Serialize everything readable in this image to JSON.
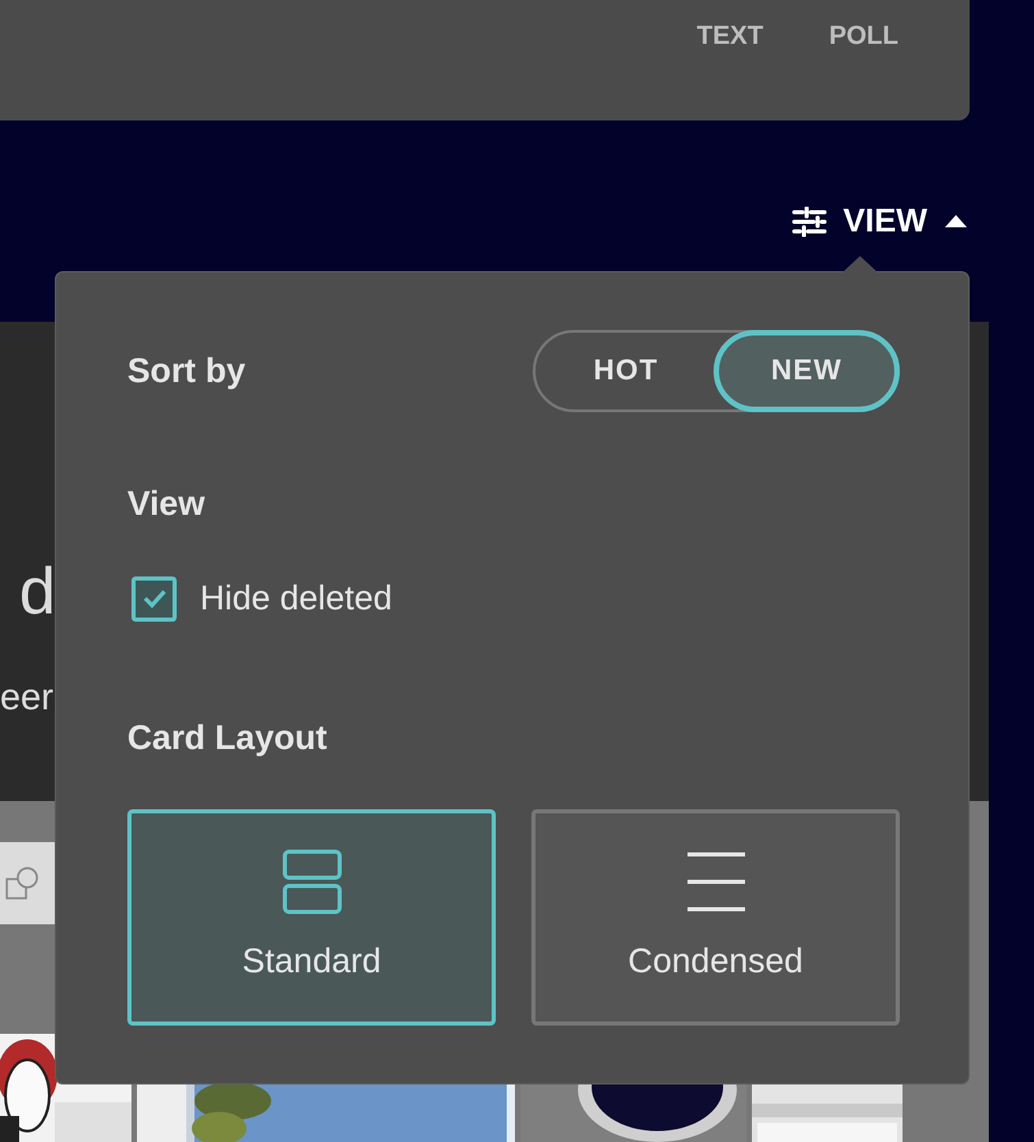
{
  "top_tabs": [
    {
      "label": "TEXT"
    },
    {
      "label": "POLL"
    }
  ],
  "view_button": {
    "label": "VIEW",
    "expanded": true
  },
  "background": {
    "title_fragment": "d",
    "subtitle_fragment": "eer"
  },
  "dropdown": {
    "sort": {
      "label": "Sort by",
      "options": [
        {
          "label": "HOT",
          "selected": false
        },
        {
          "label": "NEW",
          "selected": true
        }
      ]
    },
    "view": {
      "label": "View",
      "options": [
        {
          "label": "Hide deleted",
          "checked": true
        }
      ]
    },
    "card_layout": {
      "label": "Card Layout",
      "options": [
        {
          "label": "Standard",
          "kind": "stacked",
          "selected": true
        },
        {
          "label": "Condensed",
          "kind": "lines",
          "selected": false
        }
      ]
    }
  }
}
